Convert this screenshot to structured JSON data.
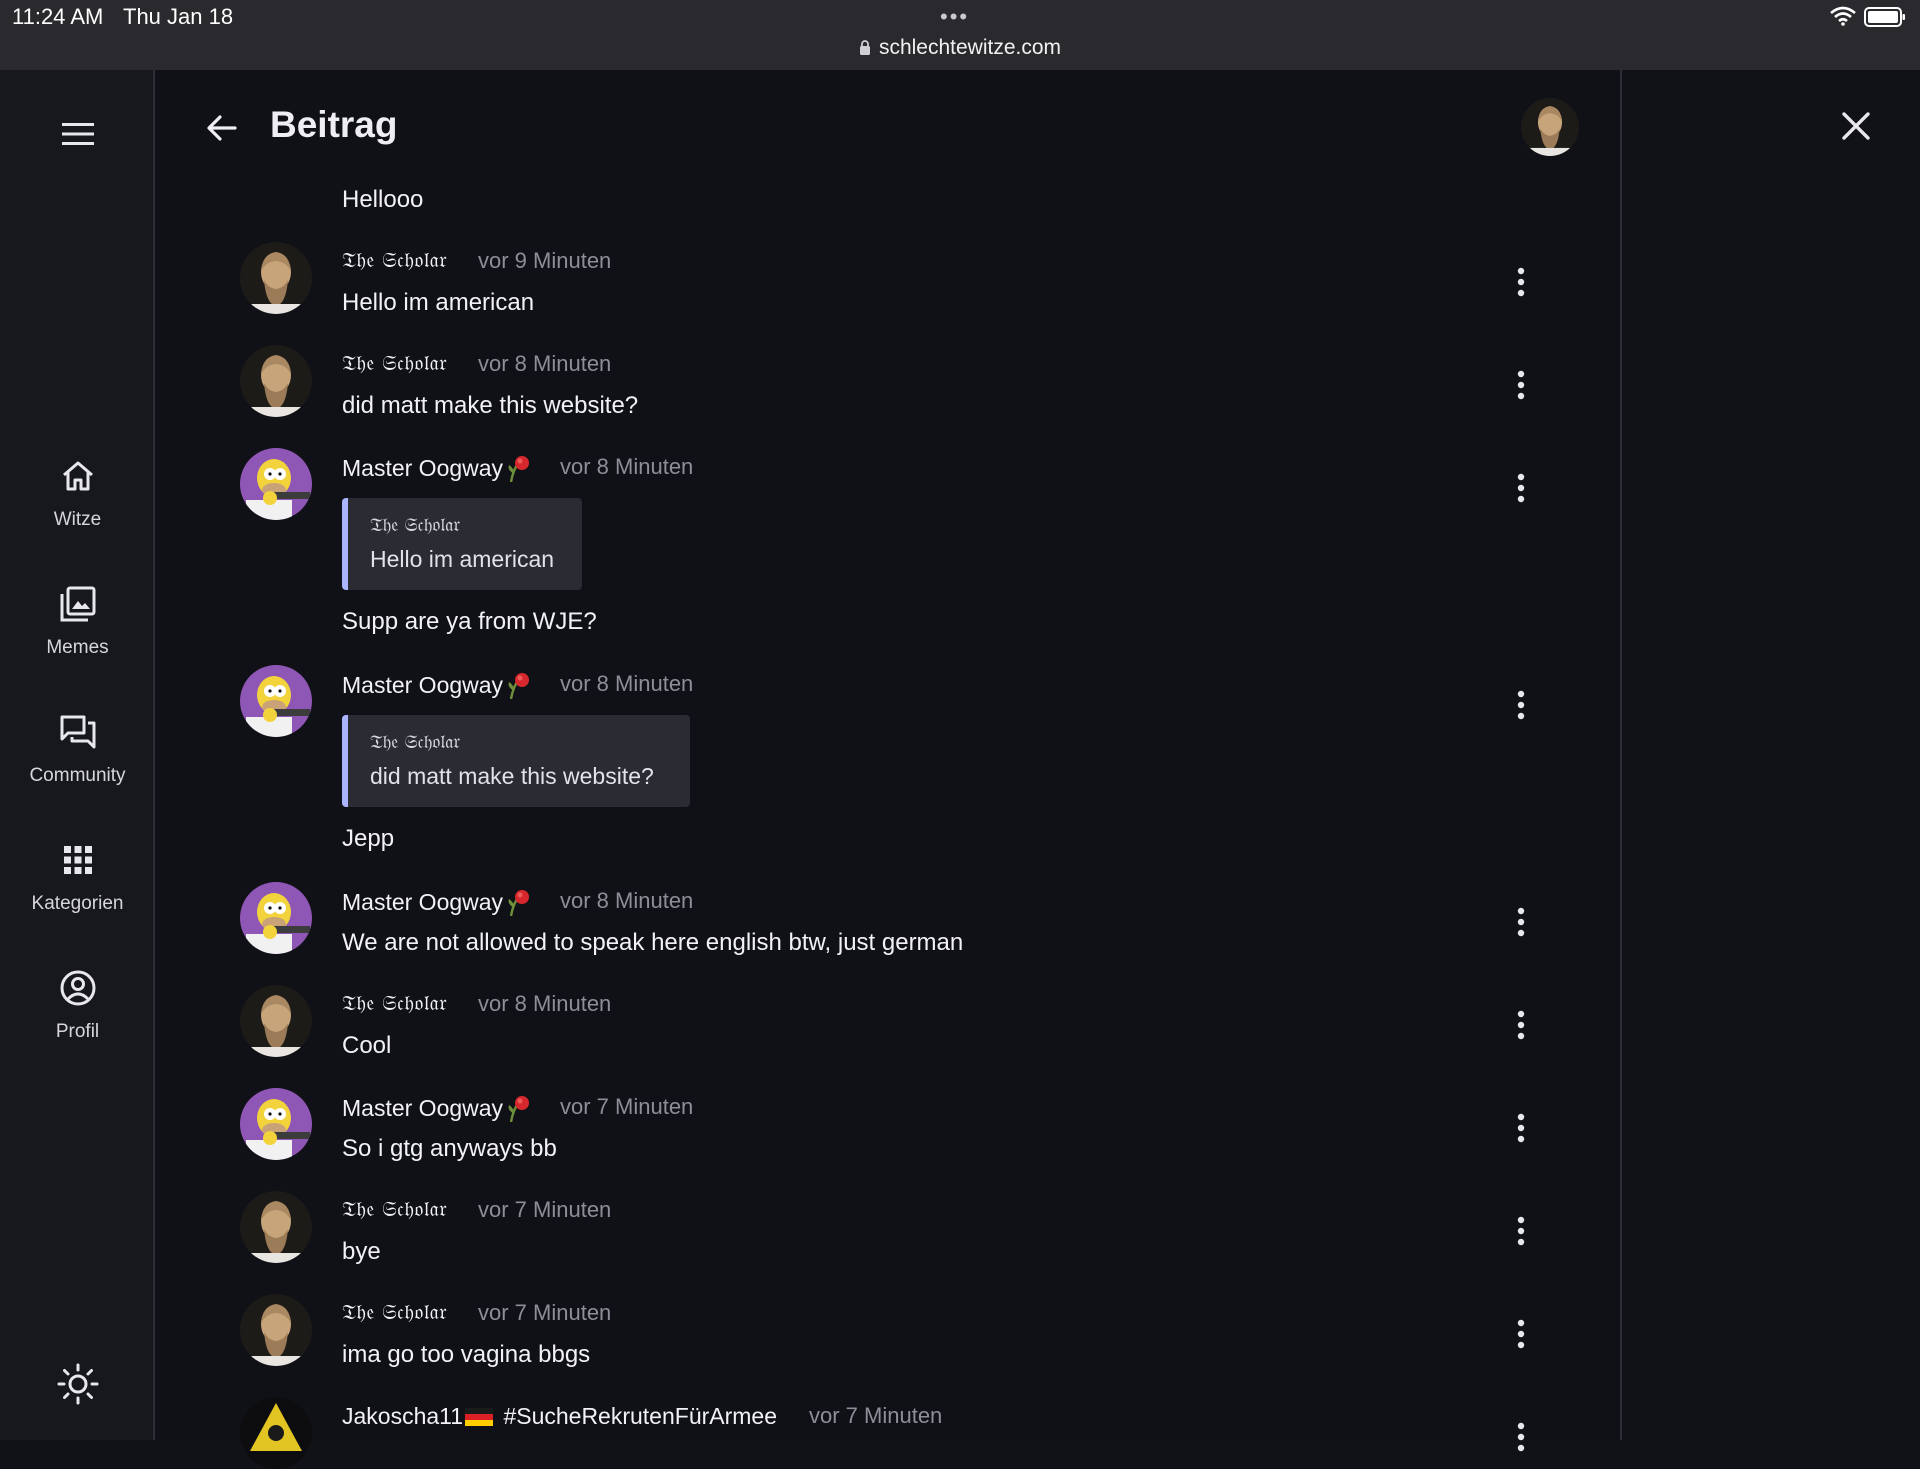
{
  "status": {
    "time": "11:24 AM",
    "date": "Thu Jan 18",
    "dots": "•••",
    "url": "schlechtewitze.com"
  },
  "header": {
    "title": "Beitrag"
  },
  "sidebar": {
    "items": [
      {
        "label": "Witze",
        "icon": "home-icon"
      },
      {
        "label": "Memes",
        "icon": "image-gallery-icon"
      },
      {
        "label": "Community",
        "icon": "chat-icon"
      },
      {
        "label": "Kategorien",
        "icon": "apps-grid-icon"
      },
      {
        "label": "Profil",
        "icon": "account-circle-icon"
      }
    ]
  },
  "messages": [
    {
      "text": "Hellooo"
    },
    {
      "author": "𝔗𝔥𝔢 𝔖𝔠𝔥𝔬𝔩𝔞𝔯",
      "time": "vor 9 Minuten",
      "text": "Hello im american"
    },
    {
      "author": "𝔗𝔥𝔢 𝔖𝔠𝔥𝔬𝔩𝔞𝔯",
      "time": "vor 8 Minuten",
      "text": "did matt make this website?"
    },
    {
      "author": "Master Oogway",
      "time": "vor 8 Minuten",
      "quote_author": "𝔗𝔥𝔢 𝔖𝔠𝔥𝔬𝔩𝔞𝔯",
      "quote_text": "Hello im american",
      "text": "Supp are ya from WJE?"
    },
    {
      "author": "Master Oogway",
      "time": "vor 8 Minuten",
      "quote_author": "𝔗𝔥𝔢 𝔖𝔠𝔥𝔬𝔩𝔞𝔯",
      "quote_text": "did matt make this website?",
      "text": "Jepp"
    },
    {
      "author": "Master Oogway",
      "time": "vor 8 Minuten",
      "text": "We are not allowed to speak here english btw, just german"
    },
    {
      "author": "𝔗𝔥𝔢 𝔖𝔠𝔥𝔬𝔩𝔞𝔯",
      "time": "vor 8 Minuten",
      "text": "Cool"
    },
    {
      "author": "Master Oogway",
      "time": "vor 7 Minuten",
      "text": "So i gtg anyways bb"
    },
    {
      "author": "𝔗𝔥𝔢 𝔖𝔠𝔥𝔬𝔩𝔞𝔯",
      "time": "vor 7 Minuten",
      "text": "bye"
    },
    {
      "author": "𝔗𝔥𝔢 𝔖𝔠𝔥𝔬𝔩𝔞𝔯",
      "time": "vor 7 Minuten",
      "text": "ima go too vagina bbgs"
    },
    {
      "author": "Jakoscha11",
      "author_suffix": "#SucheRekrutenFürArmee",
      "time": "vor 7 Minuten"
    }
  ],
  "colors": {
    "background": "#101117",
    "rail": "#17181d",
    "quote_bar": "#aab4ff",
    "muted_text": "#8d8e98"
  }
}
